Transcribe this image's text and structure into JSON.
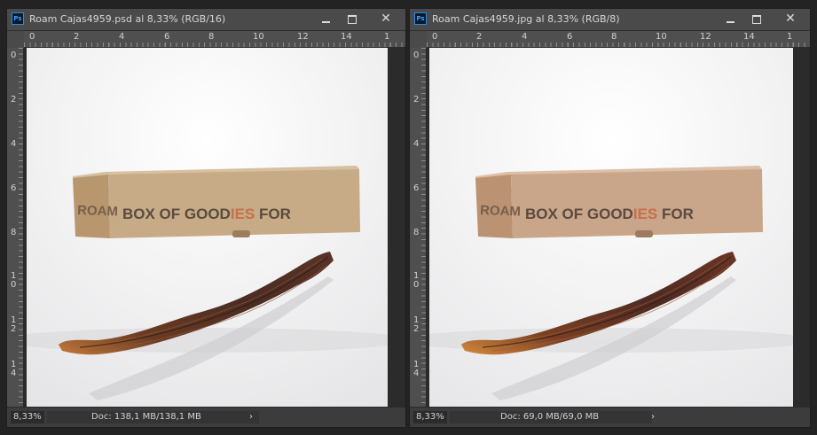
{
  "windows": [
    {
      "title": "Roam Cajas4959.psd al 8,33% (RGB/16)",
      "icon": "ps-icon",
      "app_icon_text": "Ps",
      "ruler_h": [
        "0",
        "2",
        "4",
        "6",
        "8",
        "10",
        "12",
        "14",
        "1"
      ],
      "ruler_v": [
        "0",
        "2",
        "4",
        "6",
        "8",
        "1\n0",
        "1\n2",
        "1\n4"
      ],
      "zoom": "8,33%",
      "doc": "Doc: 138,1 MB/138,1 MB",
      "status_arrow": "›",
      "photo": {
        "box_text_main": "BOX OF GOOD",
        "box_text_accent": "IES",
        "box_text_end": " FOR",
        "box_brand": "ROAM",
        "box_color": "#c7aa86",
        "accent_color": "#c6714b"
      }
    },
    {
      "title": "Roam Cajas4959.jpg al 8,33% (RGB/8)",
      "icon": "ps-icon",
      "app_icon_text": "Ps",
      "ruler_h": [
        "0",
        "2",
        "4",
        "6",
        "8",
        "10",
        "12",
        "14",
        "1"
      ],
      "ruler_v": [
        "0",
        "2",
        "4",
        "6",
        "8",
        "1\n0",
        "1\n2",
        "1\n4"
      ],
      "zoom": "8,33%",
      "doc": "Doc: 69,0 MB/69,0 MB",
      "status_arrow": "›",
      "photo": {
        "box_text_main": "BOX OF GOOD",
        "box_text_accent": "IES",
        "box_text_end": " FOR",
        "box_brand": "ROAM",
        "box_color": "#c9a689",
        "accent_color": "#c76e4c"
      }
    }
  ],
  "controls": {
    "minimize_icon": "minimize-icon",
    "maximize_icon": "maximize-icon",
    "close_icon": "close-icon",
    "close_glyph": "✕"
  }
}
